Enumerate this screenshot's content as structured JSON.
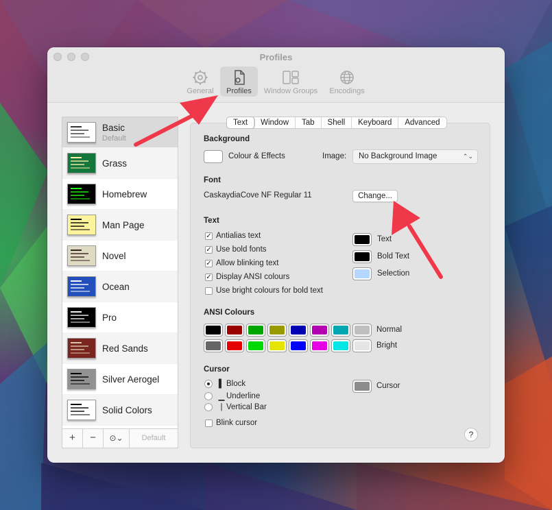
{
  "window": {
    "title": "Profiles"
  },
  "toolbar": [
    {
      "label": "General",
      "icon": "gear-icon"
    },
    {
      "label": "Profiles",
      "icon": "profile-document-icon",
      "selected": true
    },
    {
      "label": "Window Groups",
      "icon": "window-groups-icon"
    },
    {
      "label": "Encodings",
      "icon": "globe-icon"
    }
  ],
  "profiles": [
    {
      "name": "Basic",
      "sub": "Default",
      "bg": "#ffffff",
      "fg": "#333333",
      "selected": true
    },
    {
      "name": "Grass",
      "bg": "#13773d",
      "fg": "#fff0a5"
    },
    {
      "name": "Homebrew",
      "bg": "#000000",
      "fg": "#28fe14"
    },
    {
      "name": "Man Page",
      "bg": "#fef49c",
      "fg": "#000000"
    },
    {
      "name": "Novel",
      "bg": "#dfdbc3",
      "fg": "#3b2322"
    },
    {
      "name": "Ocean",
      "bg": "#224fbc",
      "fg": "#ffffff"
    },
    {
      "name": "Pro",
      "bg": "#000000",
      "fg": "#f2f2f2"
    },
    {
      "name": "Red Sands",
      "bg": "#7a251e",
      "fg": "#d7c9a7"
    },
    {
      "name": "Silver Aerogel",
      "bg": "#929292",
      "fg": "#000000"
    },
    {
      "name": "Solid Colors",
      "bg": "#ffffff",
      "fg": "#000000"
    }
  ],
  "sidebar_buttons": {
    "add": "+",
    "remove": "−",
    "menu": "⊙⌄",
    "default": "Default"
  },
  "tabs": [
    "Text",
    "Window",
    "Tab",
    "Shell",
    "Keyboard",
    "Advanced"
  ],
  "background": {
    "title": "Background",
    "colour_label": "Colour & Effects",
    "image_label": "Image:",
    "image_value": "No Background Image"
  },
  "font": {
    "title": "Font",
    "value": "CaskaydiaCove NF Regular 11",
    "change_label": "Change..."
  },
  "text": {
    "title": "Text",
    "options": [
      {
        "label": "Antialias text",
        "checked": true
      },
      {
        "label": "Use bold fonts",
        "checked": true
      },
      {
        "label": "Allow blinking text",
        "checked": true
      },
      {
        "label": "Display ANSI colours",
        "checked": true
      },
      {
        "label": "Use bright colours for bold text",
        "checked": false
      }
    ],
    "colours": [
      {
        "label": "Text",
        "color": "#000000"
      },
      {
        "label": "Bold Text",
        "color": "#000000"
      },
      {
        "label": "Selection",
        "color": "#b3d7ff"
      }
    ]
  },
  "ansi": {
    "title": "ANSI Colours",
    "normal_label": "Normal",
    "bright_label": "Bright",
    "normal": [
      "#000000",
      "#990000",
      "#00a600",
      "#999900",
      "#0000b2",
      "#b200b2",
      "#00a6b2",
      "#bfbfbf"
    ],
    "bright": [
      "#666666",
      "#e50000",
      "#00d900",
      "#e5e500",
      "#0000ff",
      "#e500e5",
      "#00e5e5",
      "#e5e5e5"
    ]
  },
  "cursor": {
    "title": "Cursor",
    "options": [
      {
        "glyph": "▌",
        "label": "Block",
        "selected": true
      },
      {
        "glyph": "▁",
        "label": "Underline",
        "selected": false
      },
      {
        "glyph": "|",
        "label": "Vertical Bar",
        "selected": false
      }
    ],
    "blink_label": "Blink cursor",
    "colour_label": "Cursor",
    "colour": "#8c8c8c"
  },
  "help": "?"
}
